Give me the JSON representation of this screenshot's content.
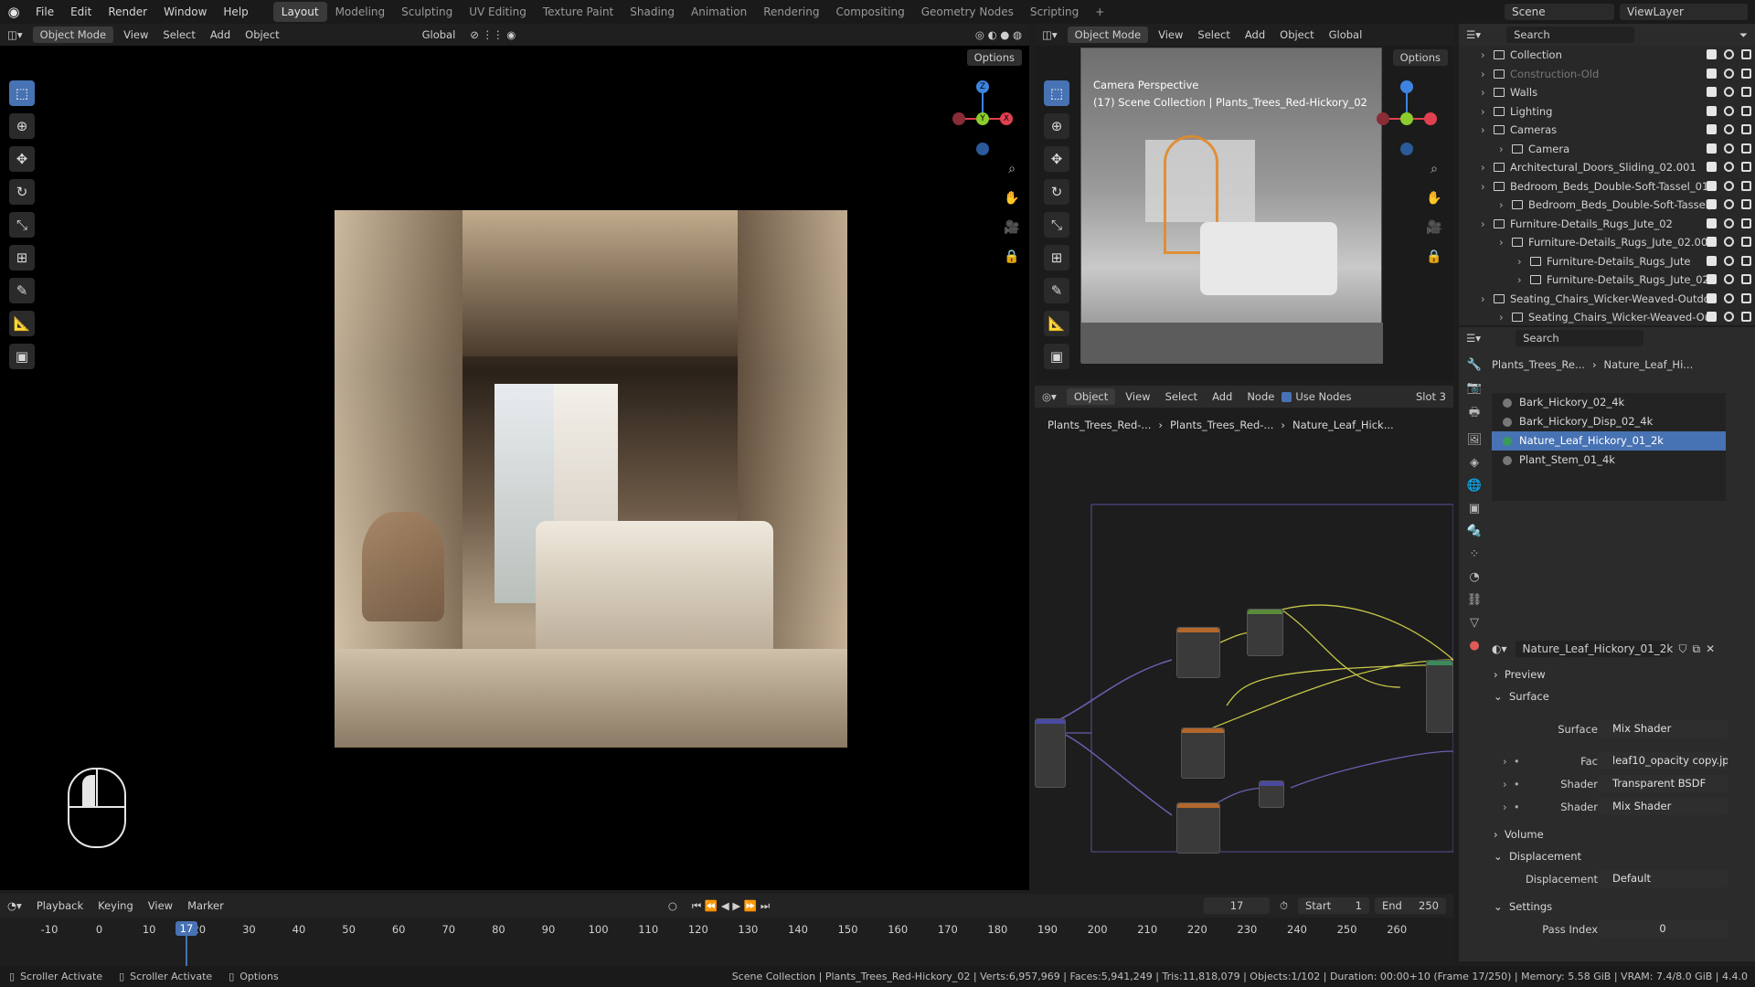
{
  "topbar": {
    "menus": [
      "File",
      "Edit",
      "Render",
      "Window",
      "Help"
    ],
    "workspaces": [
      "Layout",
      "Modeling",
      "Sculpting",
      "UV Editing",
      "Texture Paint",
      "Shading",
      "Animation",
      "Rendering",
      "Compositing",
      "Geometry Nodes",
      "Scripting"
    ],
    "active_workspace": "Layout",
    "scene": "Scene",
    "view_layer": "ViewLayer"
  },
  "left_viewport": {
    "mode": "Object Mode",
    "menus": [
      "View",
      "Select",
      "Add",
      "Object"
    ],
    "transform": "Global",
    "options": "Options"
  },
  "right_viewport": {
    "mode": "Object Mode",
    "menus": [
      "View",
      "Select",
      "Add",
      "Object"
    ],
    "transform": "Global",
    "options": "Options",
    "overlay_line1": "Camera Perspective",
    "overlay_line2": "(17) Scene Collection | Plants_Trees_Red-Hickory_02"
  },
  "gizmo": {
    "z": "Z",
    "y": "Y",
    "x": "X"
  },
  "outliner": {
    "search_placeholder": "Search",
    "rows": [
      {
        "label": "Collection",
        "indent": 0,
        "faded": false
      },
      {
        "label": "Construction-Old",
        "indent": 0,
        "faded": true
      },
      {
        "label": "Walls",
        "indent": 0,
        "faded": false
      },
      {
        "label": "Lighting",
        "indent": 0,
        "faded": false
      },
      {
        "label": "Cameras",
        "indent": 0,
        "faded": false
      },
      {
        "label": "Camera",
        "indent": 1,
        "faded": false
      },
      {
        "label": "Architectural_Doors_Sliding_02.001",
        "indent": 0,
        "faded": false
      },
      {
        "label": "Bedroom_Beds_Double-Soft-Tassel_01.",
        "indent": 0,
        "faded": false
      },
      {
        "label": "Bedroom_Beds_Double-Soft-Tassel,",
        "indent": 1,
        "faded": false
      },
      {
        "label": "Furniture-Details_Rugs_Jute_02",
        "indent": 0,
        "faded": false
      },
      {
        "label": "Furniture-Details_Rugs_Jute_02.001",
        "indent": 1,
        "faded": false
      },
      {
        "label": "Furniture-Details_Rugs_Jute",
        "indent": 2,
        "faded": false
      },
      {
        "label": "Furniture-Details_Rugs_Jute_02.",
        "indent": 2,
        "faded": false
      },
      {
        "label": "Seating_Chairs_Wicker-Weaved-Outdo",
        "indent": 0,
        "faded": false
      },
      {
        "label": "Seating_Chairs_Wicker-Weaved-Ou",
        "indent": 1,
        "faded": false
      }
    ]
  },
  "node_editor": {
    "type": "Object",
    "menus": [
      "View",
      "Select",
      "Add",
      "Node"
    ],
    "use_nodes": "Use Nodes",
    "slot": "Slot 3",
    "breadcrumb": [
      "Plants_Trees_Red-...",
      "Plants_Trees_Red-...",
      "Nature_Leaf_Hick..."
    ]
  },
  "properties": {
    "search_placeholder": "Search",
    "breadcrumb_obj": "Plants_Trees_Re...",
    "breadcrumb_mat": "Nature_Leaf_Hi...",
    "materials": [
      "Bark_Hickory_02_4k",
      "Bark_Hickory_Disp_02_4k",
      "Nature_Leaf_Hickory_01_2k",
      "Plant_Stem_01_4k"
    ],
    "selected_material": "Nature_Leaf_Hickory_01_2k",
    "material_name": "Nature_Leaf_Hickory_01_2k",
    "sections": {
      "preview": "Preview",
      "surface": "Surface",
      "volume": "Volume",
      "displacement": "Displacement",
      "settings": "Settings"
    },
    "surface_rows": [
      {
        "label": "Surface",
        "value": "Mix Shader"
      },
      {
        "label": "Fac",
        "value": "leaf10_opacity copy.jp..."
      },
      {
        "label": "Shader",
        "value": "Transparent BSDF"
      },
      {
        "label": "Shader",
        "value": "Mix Shader"
      }
    ],
    "displacement": {
      "label": "Displacement",
      "value": "Default"
    },
    "pass_index": {
      "label": "Pass Index",
      "value": "0"
    }
  },
  "timeline": {
    "menus": [
      "Playback",
      "Keying",
      "View",
      "Marker"
    ],
    "current_frame": "17",
    "start_label": "Start",
    "start": "1",
    "end_label": "End",
    "end": "250",
    "ticks": [
      "-10",
      "0",
      "10",
      "20",
      "30",
      "40",
      "50",
      "60",
      "70",
      "80",
      "90",
      "100",
      "110",
      "120",
      "130",
      "140",
      "150",
      "160",
      "170",
      "180",
      "190",
      "200",
      "210",
      "220",
      "230",
      "240",
      "250",
      "260"
    ],
    "playhead": "17"
  },
  "status_bar": {
    "left": [
      "Scroller Activate",
      "Scroller Activate",
      "Options"
    ],
    "right": "Scene Collection | Plants_Trees_Red-Hickory_02 | Verts:6,957,969 | Faces:5,941,249 | Tris:11,818,079 | Objects:1/102 | Duration: 00:00+10 (Frame 17/250) | Memory: 5.58 GiB | VRAM: 7.4/8.0 GiB | 4.4.0"
  },
  "colors": {
    "accent": "#4772b3",
    "axis_x": "#e0404f",
    "axis_y": "#8ccc2c",
    "axis_z": "#3d84e0"
  }
}
